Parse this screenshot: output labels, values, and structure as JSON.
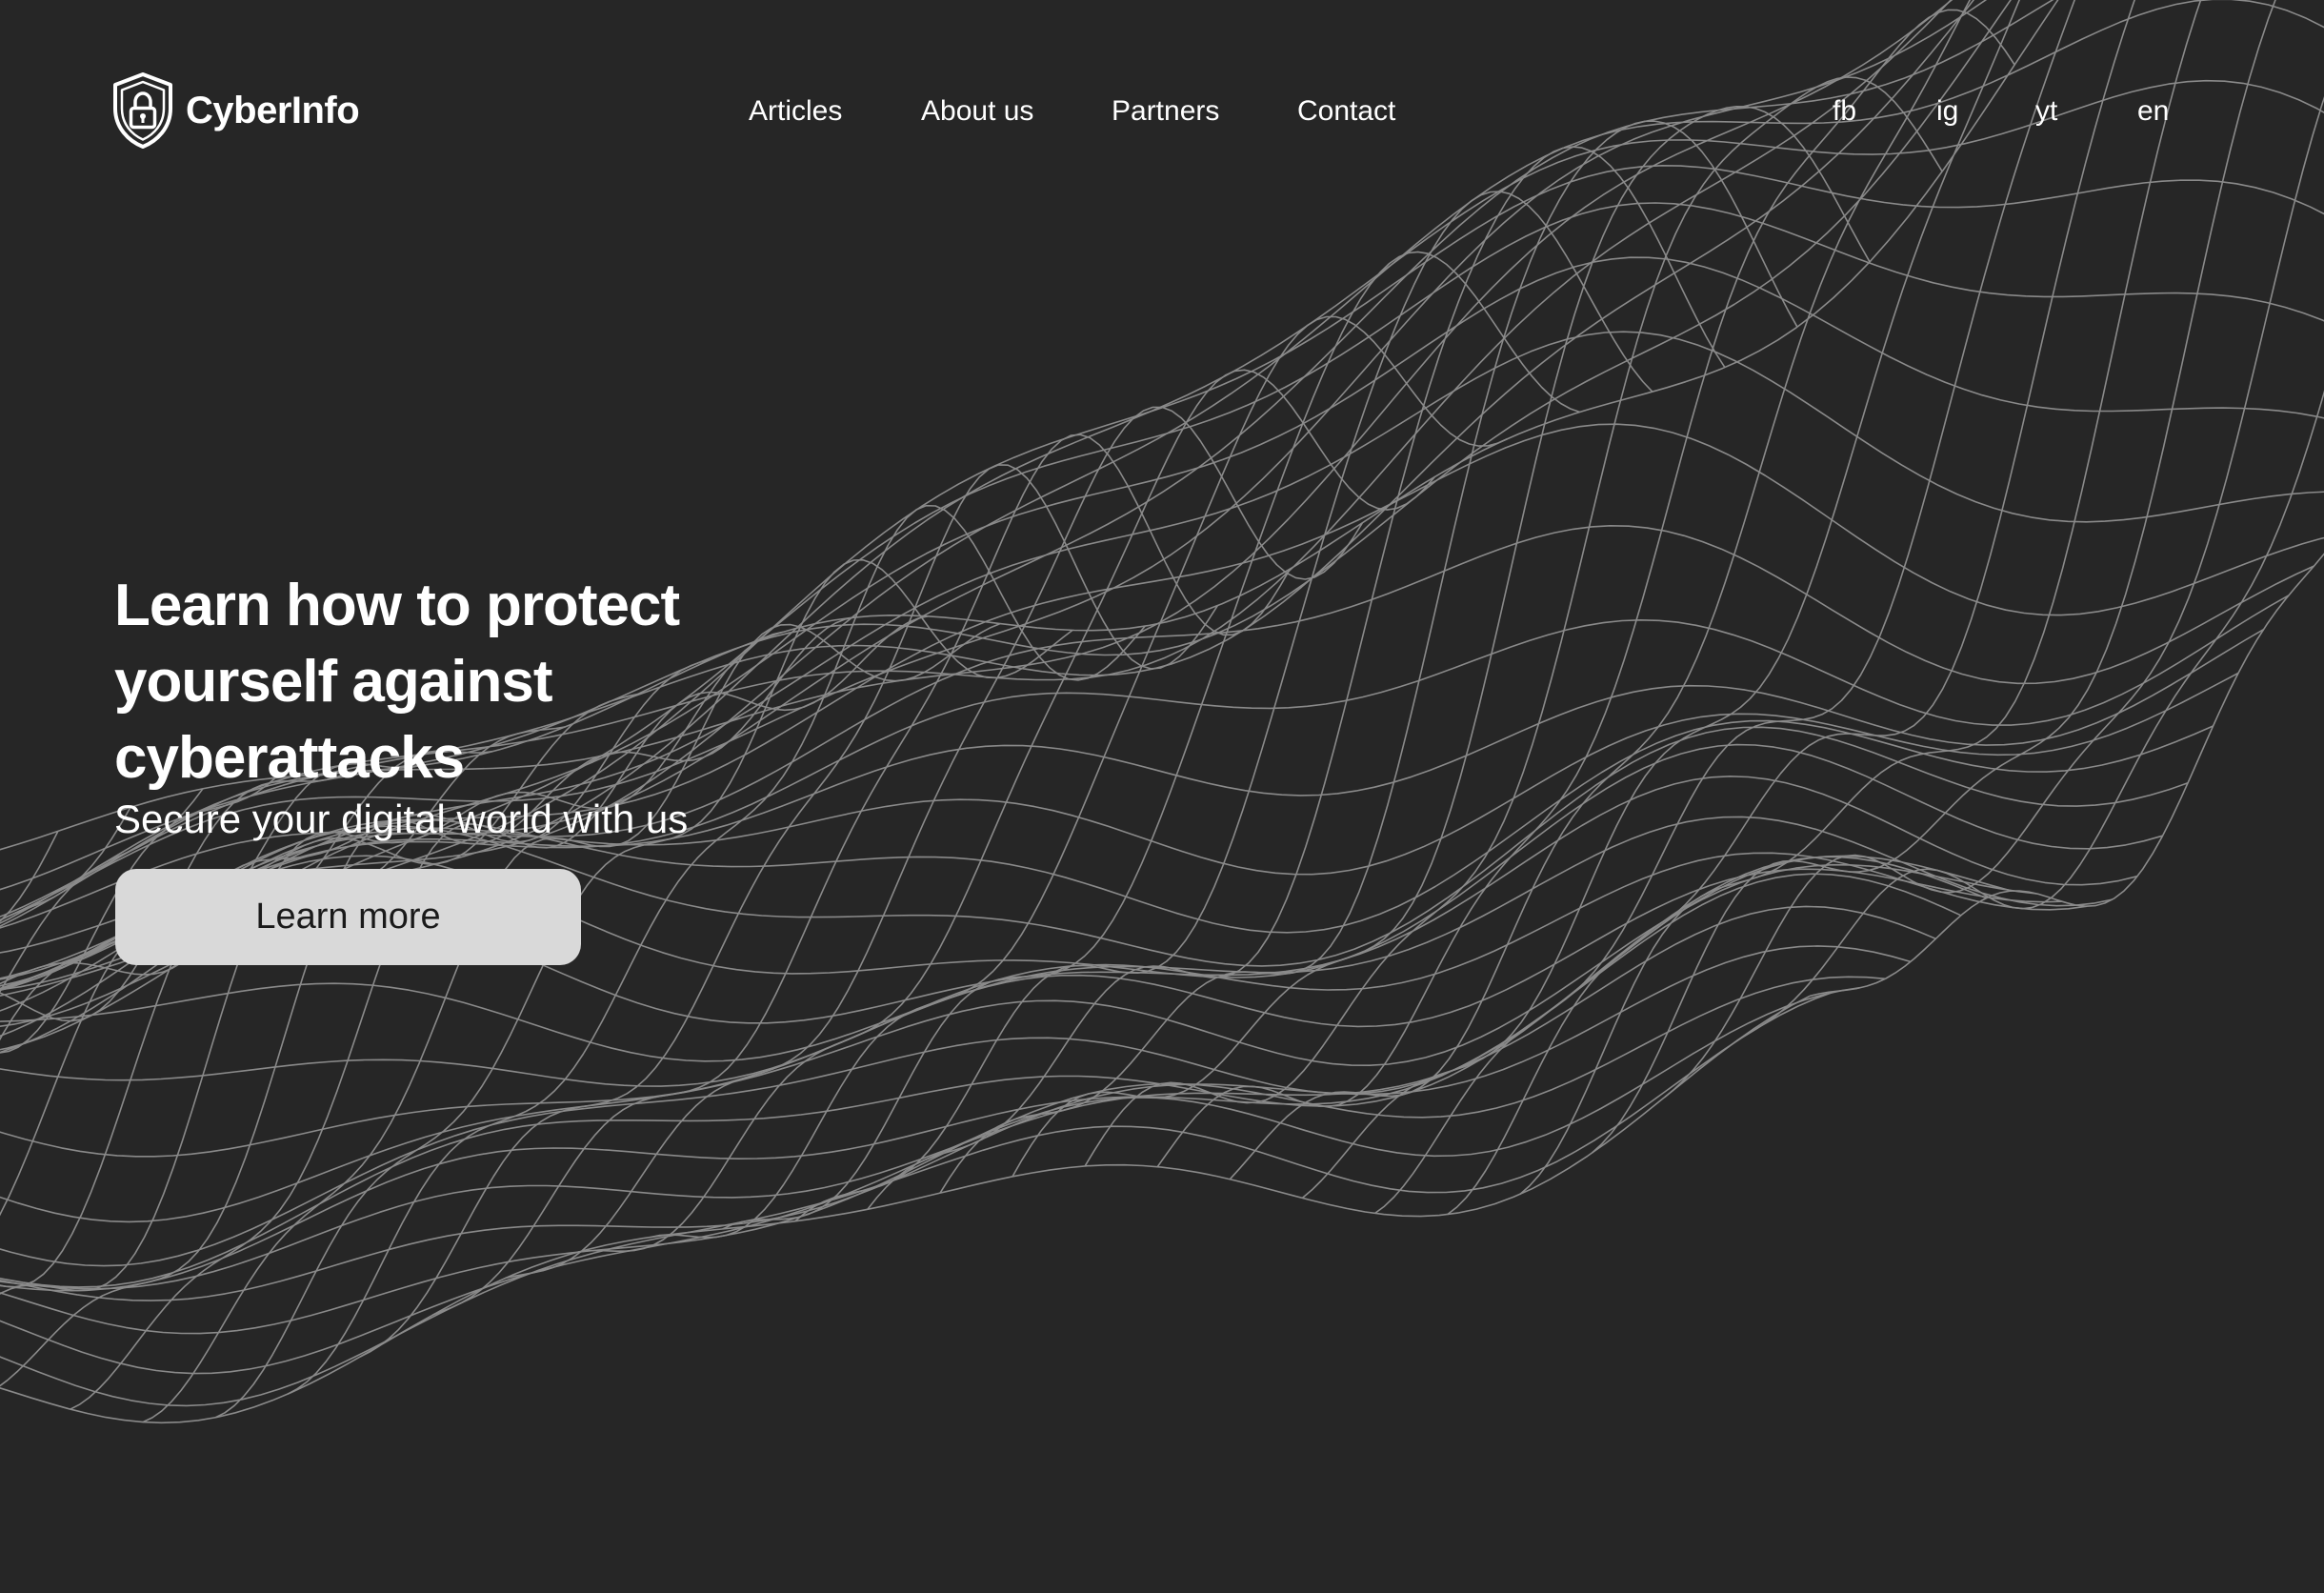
{
  "brand": {
    "name": "CyberInfo",
    "logo_icon": "shield-lock-icon"
  },
  "nav": {
    "items": [
      {
        "label": "Articles"
      },
      {
        "label": "About us"
      },
      {
        "label": "Partners"
      },
      {
        "label": "Contact"
      }
    ]
  },
  "social": {
    "items": [
      {
        "label": "fb"
      },
      {
        "label": "ig"
      },
      {
        "label": "yt"
      },
      {
        "label": "en"
      }
    ]
  },
  "hero": {
    "title": "Learn how to protect yourself against cyberattacks",
    "subtitle": "Secure your digital world with us",
    "cta_label": "Learn more"
  },
  "theme": {
    "background": "#262626",
    "text": "#ffffff",
    "button_bg": "#d9d9d9",
    "button_text": "#1a1a1a",
    "wireframe_stroke": "#8a8a8a"
  }
}
